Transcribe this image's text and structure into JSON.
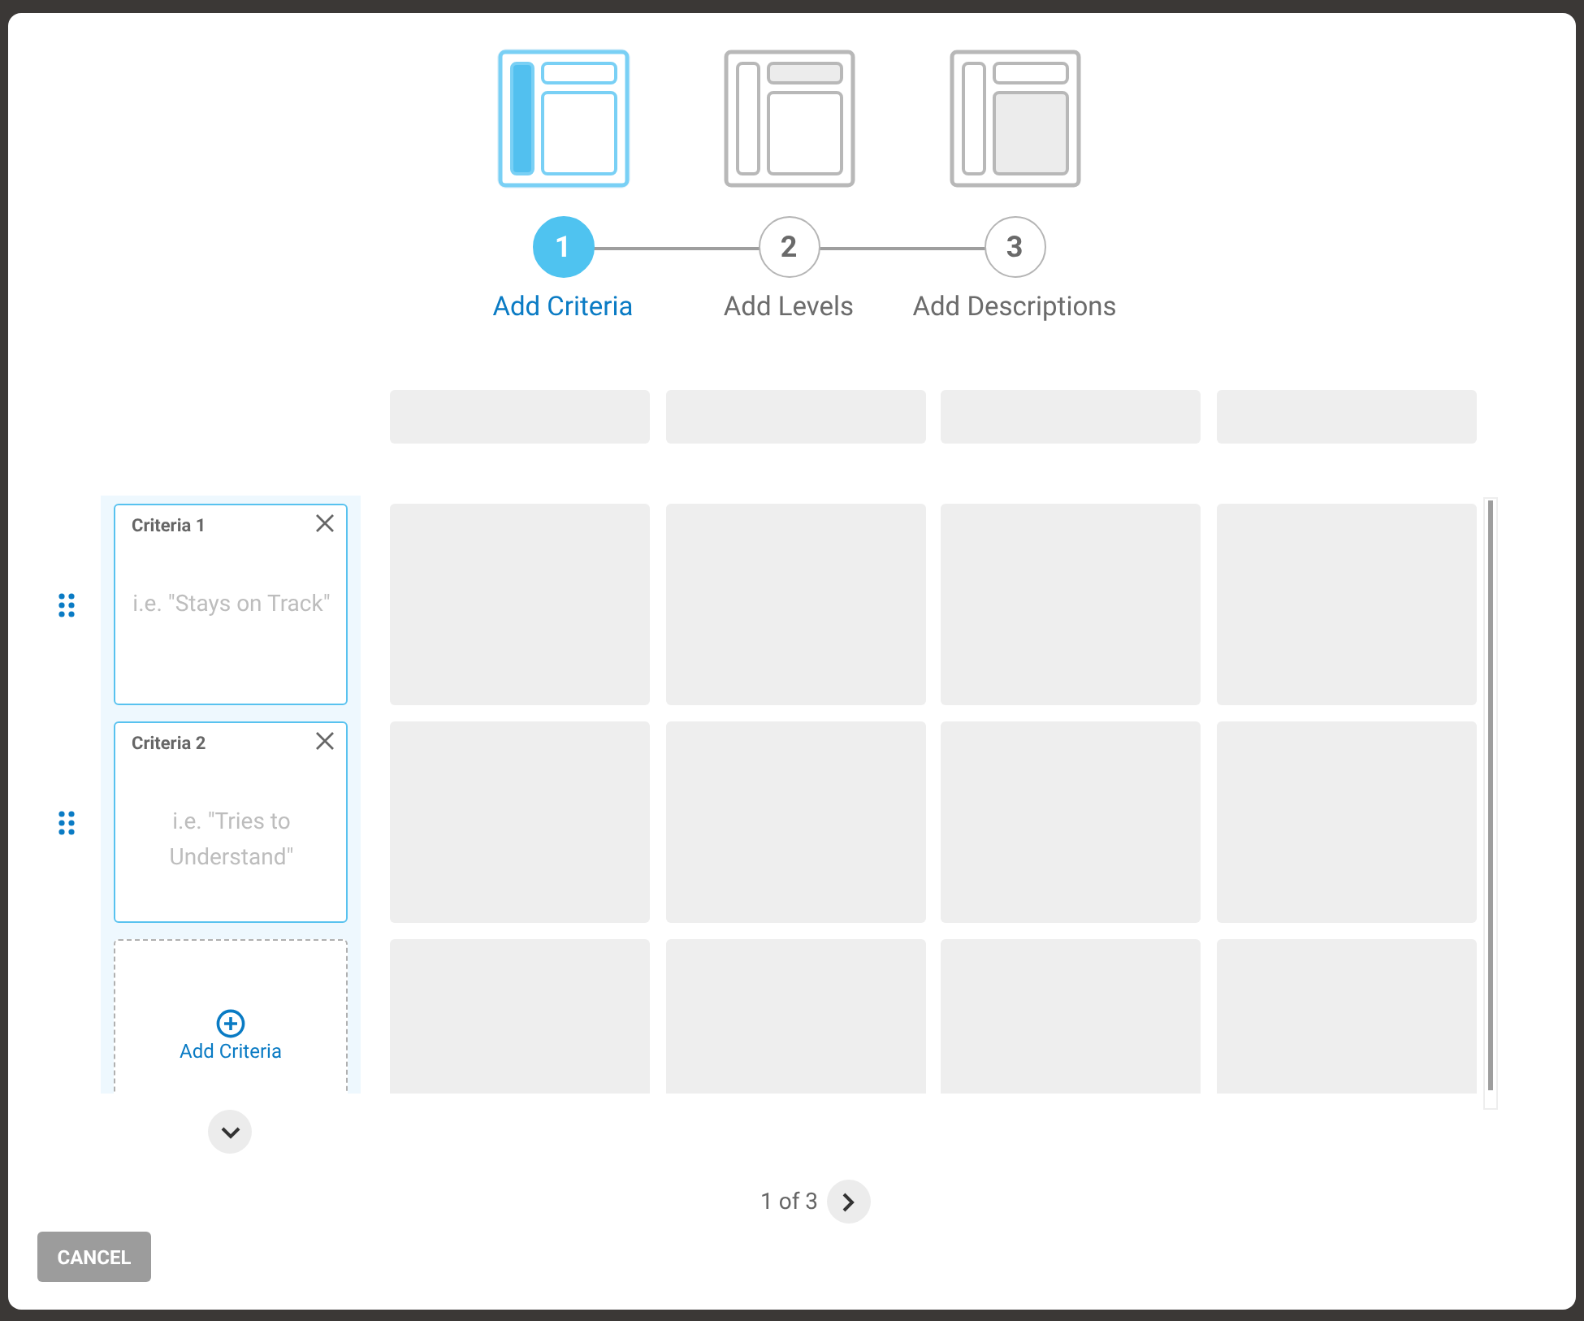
{
  "steps": [
    {
      "number": "1",
      "label": "Add Criteria",
      "selected": true
    },
    {
      "number": "2",
      "label": "Add Levels",
      "selected": false
    },
    {
      "number": "3",
      "label": "Add Descriptions",
      "selected": false
    }
  ],
  "criteria": [
    {
      "title": "Criteria 1",
      "placeholder": "i.e. \"Stays on Track\""
    },
    {
      "title": "Criteria 2",
      "placeholder": "i.e. \"Tries to Understand\""
    }
  ],
  "add_criteria": "Add Criteria",
  "pager": "1 of 3",
  "cancel": "CANCEL"
}
